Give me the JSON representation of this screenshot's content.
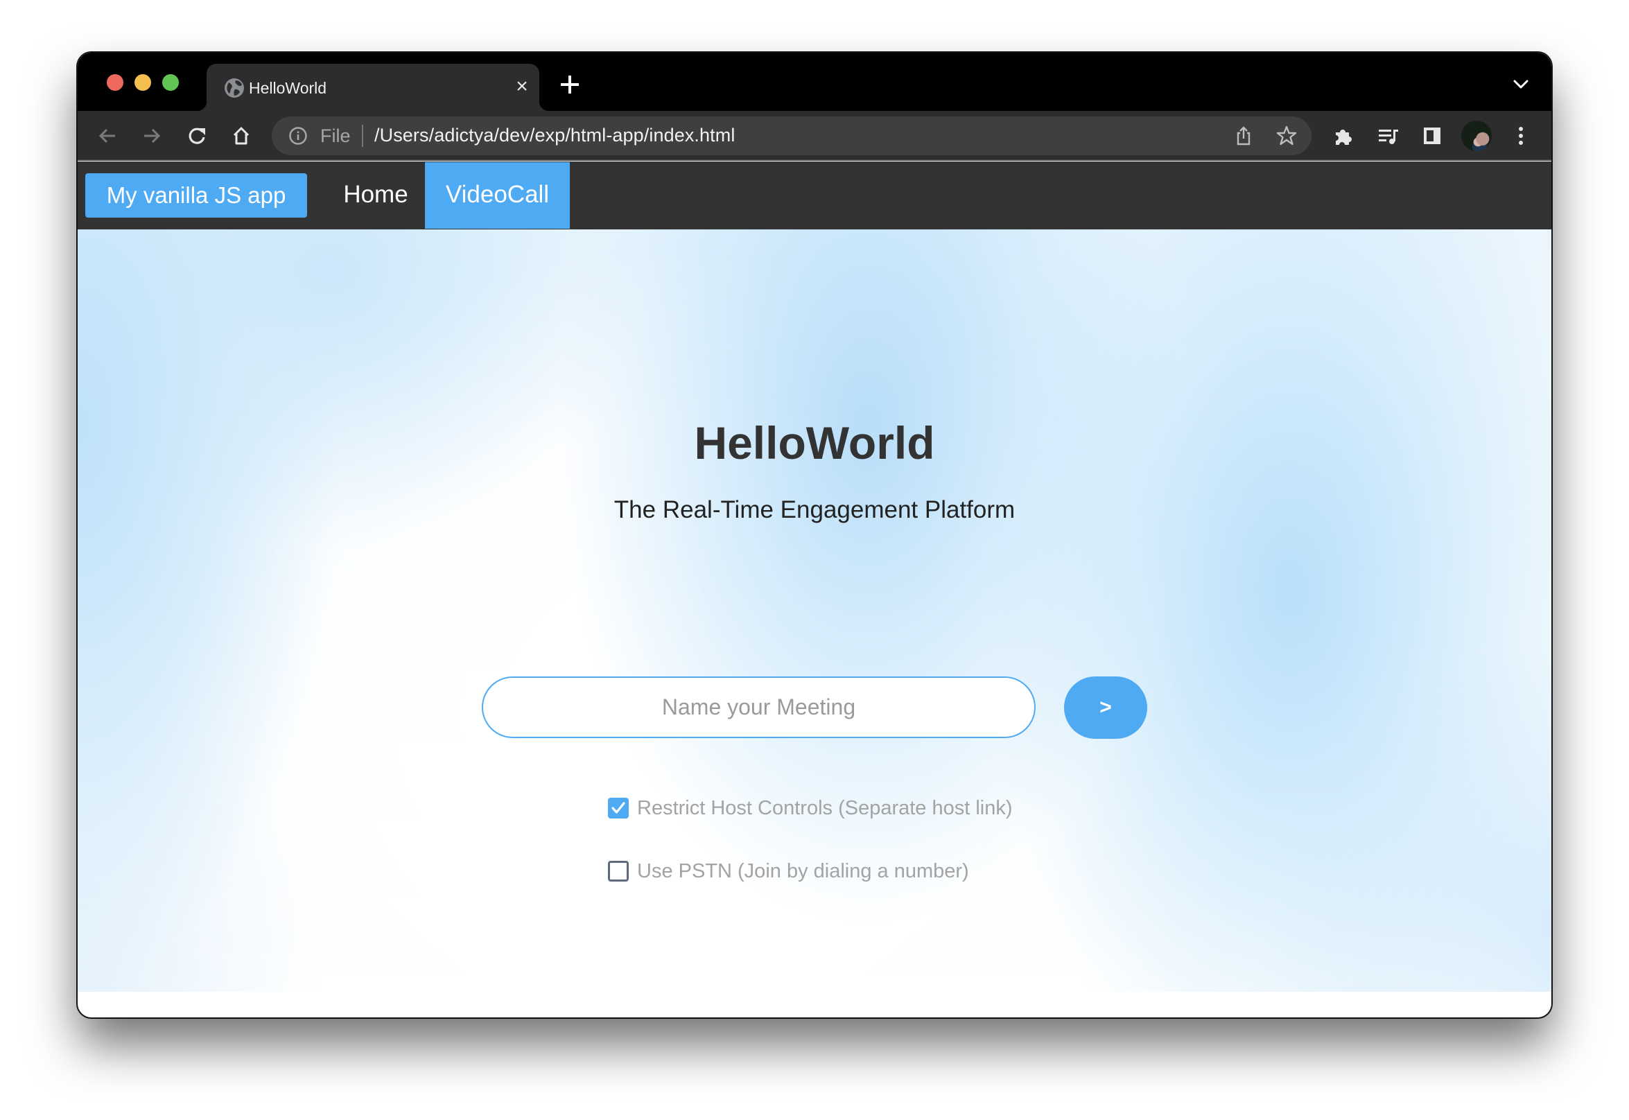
{
  "browser": {
    "tab": {
      "title": "HelloWorld",
      "icon": "globe-icon",
      "close_glyph": "×"
    },
    "new_tab_icon": "plus-icon",
    "tab_search_icon": "chevron-down-icon",
    "nav": {
      "back_icon": "arrow-left-icon",
      "forward_icon": "arrow-right-icon",
      "reload_icon": "reload-icon",
      "home_icon": "home-icon"
    },
    "omnibox": {
      "scheme_label": "File",
      "url": "/Users/adictya/dev/exp/html-app/index.html",
      "info_icon": "info-icon",
      "share_icon": "share-icon",
      "bookmark_icon": "star-icon"
    },
    "toolbar_right": {
      "extensions_icon": "puzzle-icon",
      "media_icon": "media-queue-icon",
      "side_panel_icon": "side-panel-icon",
      "profile": "avatar",
      "menu_icon": "kebab-menu-icon"
    },
    "traffic_lights": {
      "close_color": "#ee6a5e",
      "minimize_color": "#f5bf4f",
      "zoom_color": "#61c554"
    }
  },
  "app": {
    "navbar": {
      "brand": "My vanilla JS app",
      "links": [
        {
          "label": "Home",
          "active": false
        },
        {
          "label": "VideoCall",
          "active": true
        }
      ]
    },
    "hero": {
      "title": "HelloWorld",
      "subtitle": "The Real-Time Engagement Platform"
    },
    "meeting_form": {
      "input_value": "",
      "input_placeholder": "Name your Meeting",
      "submit_label": ">",
      "options": [
        {
          "label": "Restrict Host Controls (Separate host link)",
          "checked": true
        },
        {
          "label": "Use PSTN (Join by dialing a number)",
          "checked": false
        }
      ]
    },
    "colors": {
      "accent": "#4faaf4",
      "navbar_bg": "#333333",
      "title_text": "#333333",
      "muted_text": "#a3a3a3"
    }
  }
}
